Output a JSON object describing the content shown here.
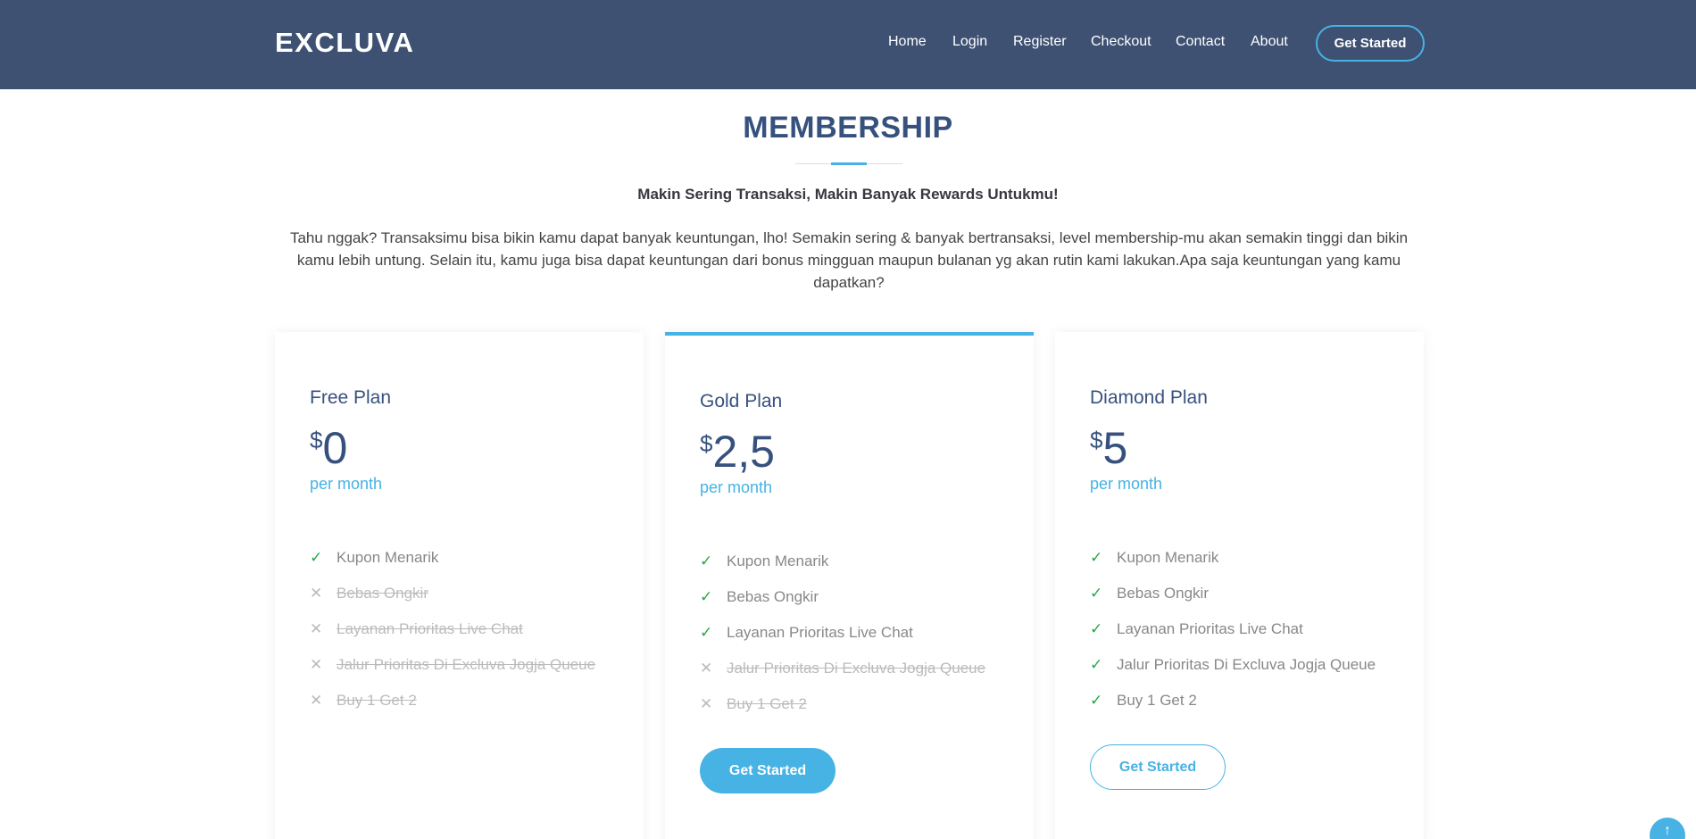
{
  "brand": {
    "logo": "EXCLUVA",
    "accent": "#47b2e4",
    "header_bg": "#3e5172",
    "title_color": "#37517e"
  },
  "nav": {
    "home": "Home",
    "login": "Login",
    "register": "Register",
    "checkout": "Checkout",
    "contact": "Contact",
    "about": "About",
    "cta": "Get Started"
  },
  "section": {
    "title": "MEMBERSHIP",
    "subtitle": "Makin Sering Transaksi, Makin Banyak Rewards Untukmu!",
    "description": "Tahu nggak? Transaksimu bisa bikin kamu dapat banyak keuntungan, lho! Semakin sering & banyak bertransaksi, level membership-mu akan semakin tinggi dan bikin kamu lebih untung. Selain itu, kamu juga bisa dapat keuntungan dari bonus mingguan maupun bulanan yg akan rutin kami lakukan.Apa saja keuntungan yang kamu dapatkan?"
  },
  "plans": [
    {
      "name": "Free Plan",
      "currency": "$",
      "price": "0",
      "period": "per month",
      "features": [
        {
          "label": "Kupon Menarik",
          "included": true
        },
        {
          "label": "Bebas Ongkir",
          "included": false
        },
        {
          "label": "Layanan Prioritas Live Chat",
          "included": false
        },
        {
          "label": "Jalur Prioritas Di Excluva Jogja Queue",
          "included": false
        },
        {
          "label": "Buy 1 Get 2",
          "included": false
        }
      ]
    },
    {
      "name": "Gold Plan",
      "currency": "$",
      "price": "2,5",
      "period": "per month",
      "features": [
        {
          "label": "Kupon Menarik",
          "included": true
        },
        {
          "label": "Bebas Ongkir",
          "included": true
        },
        {
          "label": "Layanan Prioritas Live Chat",
          "included": true
        },
        {
          "label": "Jalur Prioritas Di Excluva Jogja Queue",
          "included": false
        },
        {
          "label": "Buy 1 Get 2",
          "included": false
        }
      ],
      "button": "Get Started"
    },
    {
      "name": "Diamond Plan",
      "currency": "$",
      "price": "5",
      "period": "per month",
      "features": [
        {
          "label": "Kupon Menarik",
          "included": true
        },
        {
          "label": "Bebas Ongkir",
          "included": true
        },
        {
          "label": "Layanan Prioritas Live Chat",
          "included": true
        },
        {
          "label": "Jalur Prioritas Di Excluva Jogja Queue",
          "included": true
        },
        {
          "label": "Buy 1 Get 2",
          "included": true
        }
      ],
      "button": "Get Started"
    }
  ],
  "icons": {
    "check": "check-icon",
    "cross": "cross-icon",
    "back_to_top": "arrow-up-icon"
  }
}
